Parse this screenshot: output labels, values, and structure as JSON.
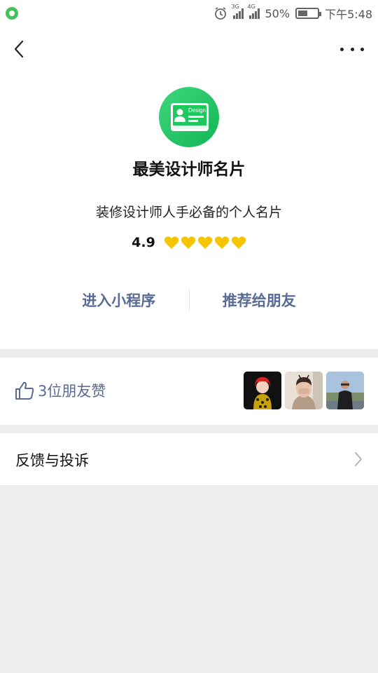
{
  "status_bar": {
    "network1": "3G",
    "network2": "4G",
    "battery": "50%",
    "battery_level": 0.5,
    "time": "下午5:48"
  },
  "app": {
    "logo_text": "Design",
    "name": "最美设计师名片",
    "description": "装修设计师人手必备的个人名片",
    "rating": "4.9",
    "hearts": 5,
    "accent_color": "#f7c400"
  },
  "actions": {
    "enter": "进入小程序",
    "share": "推荐给朋友"
  },
  "likes": {
    "text": "3位朋友赞",
    "avatars": [
      "avatar-1",
      "avatar-2",
      "avatar-3"
    ]
  },
  "feedback": {
    "label": "反馈与投诉"
  },
  "colors": {
    "link": "#576b95",
    "brand_green": "#1ec85f",
    "background": "#ededed"
  }
}
